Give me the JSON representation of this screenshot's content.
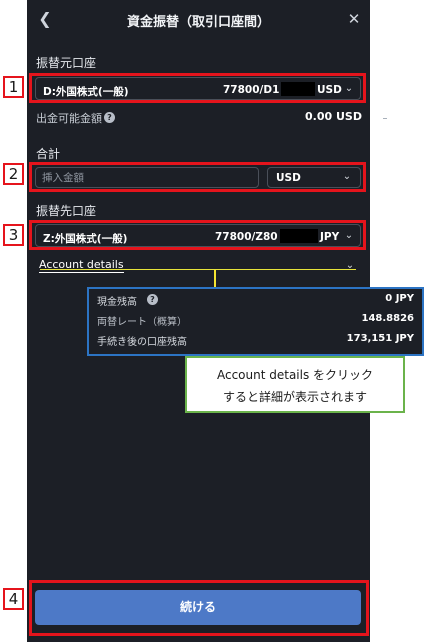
{
  "header": {
    "title": "資金振替（取引口座間）",
    "back_icon": "chevron-left-icon",
    "close_icon": "close-icon"
  },
  "source": {
    "section_label": "振替元口座",
    "account_name": "D:外国株式(一般)",
    "account_number": "77800/D1",
    "currency": "USD"
  },
  "withdrawable": {
    "label": "出金可能金額",
    "value": "0.00 USD"
  },
  "total": {
    "section_label": "合計",
    "amount_placeholder": "挿入金額",
    "currency": "USD"
  },
  "destination": {
    "section_label": "振替先口座",
    "account_name": "Z:外国株式(一般)",
    "account_number": "77800/Z80",
    "currency": "JPY"
  },
  "account_details": {
    "toggle_label": "Account details",
    "rows": [
      {
        "label": "現金残高",
        "value": "0 JPY"
      },
      {
        "label": "両替レート（概算）",
        "value": "148.8826"
      },
      {
        "label": "手続き後の口座残高",
        "value": "173,151 JPY"
      }
    ]
  },
  "annotation_note": {
    "line1": "Account details をクリック",
    "line2": "すると詳細が表示されます"
  },
  "markers": [
    "1",
    "2",
    "3",
    "4"
  ],
  "continue_button": "続ける",
  "colors": {
    "panel_bg": "#1c1f26",
    "button_blue": "#4d79c7",
    "highlight_red": "#e5141c",
    "details_border_blue": "#2c74c4",
    "note_border_green": "#6bb34b",
    "arrow_yellow": "#f4e431"
  }
}
